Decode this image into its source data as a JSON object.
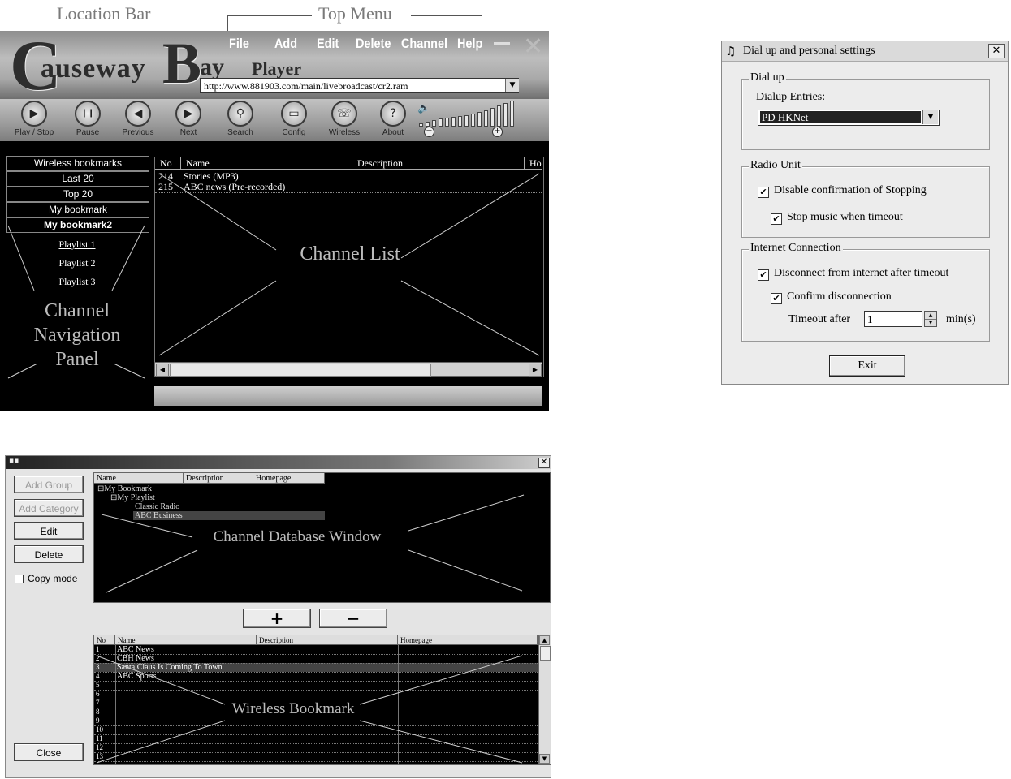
{
  "player": {
    "callouts": {
      "location_bar": "Location Bar",
      "top_menu": "Top Menu"
    },
    "logo": {
      "c": "C",
      "auseway": "auseway",
      "b": "B",
      "ay": "ay",
      "player": "Player"
    },
    "menu": [
      "File",
      "Add",
      "Edit",
      "Delete",
      "Channel",
      "Help"
    ],
    "location_url": "http://www.881903.com/main/livebroadcast/cr2.ram",
    "toolbar": [
      {
        "label": "Play / Stop",
        "icon": "play-icon",
        "glyph": "▶"
      },
      {
        "label": "Pause",
        "icon": "pause-icon",
        "glyph": "❙❙"
      },
      {
        "label": "Previous",
        "icon": "previous-icon",
        "glyph": "◀"
      },
      {
        "label": "Next",
        "icon": "next-icon",
        "glyph": "▶"
      },
      {
        "label": "Search",
        "icon": "search-icon",
        "glyph": "⚲"
      },
      {
        "label": "Config",
        "icon": "config-icon",
        "glyph": "▭"
      },
      {
        "label": "Wireless",
        "icon": "wireless-icon",
        "glyph": "☏"
      },
      {
        "label": "About",
        "icon": "about-icon",
        "glyph": "?"
      }
    ],
    "nav_tabs": [
      "Wireless bookmarks",
      "Last 20",
      "Top 20",
      "My bookmark",
      "My bookmark2"
    ],
    "nav_selected": "My bookmark2",
    "playlists": [
      "Playlist 1",
      "Playlist 2",
      "Playlist 3"
    ],
    "nav_overlay": [
      "Channel",
      "Navigation",
      "Panel"
    ],
    "channel_list": {
      "columns": [
        "No",
        "Name",
        "Description",
        "Ho"
      ],
      "rows": [
        {
          "no": "214",
          "name": "Stories (MP3)"
        },
        {
          "no": "215",
          "name": "ABC news (Pre-recorded)"
        }
      ],
      "overlay": "Channel List"
    }
  },
  "dialog": {
    "title": "Dial up and personal settings",
    "dialup": {
      "group": "Dial up",
      "entries_label": "Dialup Entries:",
      "selected": "PD HKNet"
    },
    "radio": {
      "group": "Radio Unit",
      "disable_confirm": "Disable confirmation of Stopping",
      "stop_music": "Stop music when timeout"
    },
    "internet": {
      "group": "Internet Connection",
      "disconnect": "Disconnect from internet after timeout",
      "confirm": "Confirm disconnection",
      "timeout_label": "Timeout after",
      "timeout_value": "1",
      "unit": "min(s)"
    },
    "exit": "Exit"
  },
  "database": {
    "buttons": {
      "add_group": "Add Group",
      "add_category": "Add Category",
      "edit": "Edit",
      "delete": "Delete",
      "copy_mode": "Copy mode",
      "close": "Close"
    },
    "tree_columns": [
      "Name",
      "Description",
      "Homepage"
    ],
    "tree": [
      {
        "label": "My Bookmark",
        "prefix": "⊟"
      },
      {
        "label": "My Playlist",
        "prefix": "⊟"
      },
      {
        "label": "Classic Radio",
        "prefix": ""
      },
      {
        "label": "ABC Business",
        "prefix": ""
      }
    ],
    "tree_overlay": "Channel Database Window",
    "plus": "+",
    "minus": "−",
    "list_columns": [
      "No",
      "Name",
      "Description",
      "Homepage"
    ],
    "list_rows": [
      {
        "no": "1",
        "name": "ABC News"
      },
      {
        "no": "2",
        "name": "CBH News"
      },
      {
        "no": "3",
        "name": "Santa Claus Is Coming To Town"
      },
      {
        "no": "4",
        "name": "ABC Sports"
      },
      {
        "no": "5",
        "name": ""
      },
      {
        "no": "6",
        "name": ""
      },
      {
        "no": "7",
        "name": ""
      },
      {
        "no": "8",
        "name": ""
      },
      {
        "no": "9",
        "name": ""
      },
      {
        "no": "10",
        "name": ""
      },
      {
        "no": "11",
        "name": ""
      },
      {
        "no": "12",
        "name": ""
      },
      {
        "no": "13",
        "name": ""
      }
    ],
    "list_overlay": "Wireless Bookmark"
  }
}
